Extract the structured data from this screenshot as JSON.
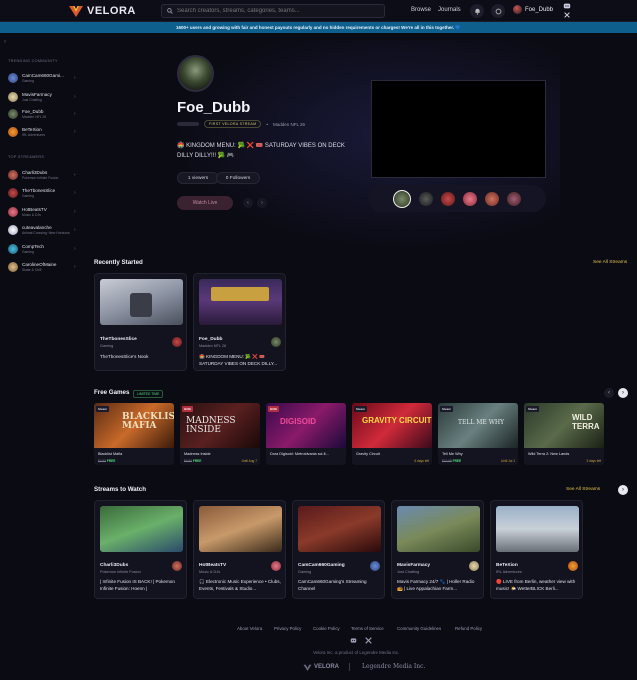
{
  "topbar": {
    "brand": "VELORA",
    "search_placeholder": "Search creators, streams, categories, teams...",
    "nav": [
      "Browse",
      "Journals"
    ],
    "user": "Foe_Dubb"
  },
  "banner": "1600+ users and growing with fair and honest payouts regularly and no hidden requirements or charges! We're all in this together. 💙",
  "sidebar": {
    "trending_heading": "TRENDING COMMUNITY",
    "trending": [
      {
        "name": "CamCam660Gami...",
        "sub": "Gaming"
      },
      {
        "name": "MavisFarmacy",
        "sub": "Just Chatting"
      },
      {
        "name": "Foe_Dubb",
        "sub": "Madden NFL 26"
      },
      {
        "name": "BeTeXion",
        "sub": "IRL Adventures"
      }
    ],
    "top_heading": "TOP STREAMERS",
    "top": [
      {
        "name": "Charli3Dubs",
        "sub": "Pokemon Infinite Fusion"
      },
      {
        "name": "TheTbonesSlice",
        "sub": "Gaming"
      },
      {
        "name": "HotBeatsTV",
        "sub": "Music & DJs"
      },
      {
        "name": "cuteavalanche",
        "sub": "Animal Crossing: New Horizons"
      },
      {
        "name": "CompTech",
        "sub": "Gaming"
      },
      {
        "name": "CarolineOfMaine",
        "sub": "Skate & Chill"
      }
    ]
  },
  "hero": {
    "name": "Foe_Dubb",
    "badge": "FIRST VELORA STREAM",
    "category": "Madden NFL 26",
    "title": "🏟️ KINGDOM MENU: 🥦 ❌ 🎟️ SATURDAY VIBES ON DECK DILLY DILLY!!! 🥦 🎮",
    "viewers": "1 viewers",
    "followers": "0 Followers",
    "watch": "Watch Live"
  },
  "recent": {
    "heading": "Recently Started",
    "see_all": "See All Streams",
    "cards": [
      {
        "name": "TheTbonesSlice",
        "sub": "Gaming",
        "desc": "TheTbonesSlice's Nook"
      },
      {
        "name": "Foe_Dubb",
        "sub": "Madden NFL 26",
        "desc": "🏟️ KINGDOM MENU: 🥦 ❌ 🎟️ SATURDAY VIBES ON DECK DILLY..."
      }
    ]
  },
  "free_games": {
    "heading": "Free Games",
    "badge": "LIMITED TIME",
    "games": [
      {
        "title": "Blacklist Mafia",
        "old": "$4.99",
        "free": "FREE",
        "days": "",
        "tag": "Steam",
        "art": "BLACKLIST MAFIA"
      },
      {
        "title": "Madness Inside",
        "old": "$9.99",
        "free": "FREE",
        "days": "Until Aug 7",
        "tag": "GOG",
        "art": "MADNESS INSIDE"
      },
      {
        "title": "Dora Digisoid: Metroidvania sci-fi...",
        "old": "",
        "free": "",
        "days": "",
        "tag": "GOG",
        "art": "DIGISOID"
      },
      {
        "title": "Gravity Circuit",
        "old": "",
        "free": "",
        "days": "6 days left",
        "tag": "Steam",
        "art": "GRAVITY CIRCUIT"
      },
      {
        "title": "Tell Me Why",
        "old": "$19.99",
        "free": "FREE",
        "days": "Until Jul 1",
        "tag": "Steam",
        "art": "TELL ME WHY"
      },
      {
        "title": "Wild Terra 2: New Lands",
        "old": "",
        "free": "",
        "days": "3 days left",
        "tag": "Steam",
        "art": "WILD TERRA"
      }
    ]
  },
  "streams": {
    "heading": "Streams to Watch",
    "see_all": "See All Streams",
    "cards": [
      {
        "name": "Charli3Dubs",
        "sub": "Pokemon Infinite Fusion",
        "desc": "| Infinite Fusion IS BACK! | Pokemon Infinite Fusion: Hoenn |"
      },
      {
        "name": "HotBeatsTV",
        "sub": "Music & DJs",
        "desc": "🎧 Electronic Music Experience • Clubs, Events, Festivals & Studio..."
      },
      {
        "name": "CamCam660Gaming",
        "sub": "Gaming",
        "desc": "CamCam660Gaming's Streaming Channel"
      },
      {
        "name": "MavisFarmacy",
        "sub": "Just Chatting",
        "desc": "Mavis Farmacy 24/7 🐾 | Holler Radio 📻 | Live Appalachian Farm..."
      },
      {
        "name": "BeTeXion",
        "sub": "IRL Adventures",
        "desc": "🔴 LIVE from Berlin, weather view with music! 🌤️ WetterBLICK Berli..."
      }
    ]
  },
  "footer": {
    "links": [
      "About Velora",
      "Privacy Policy",
      "Cookie Policy",
      "Terms of Service",
      "Community Guidelines",
      "Refund Policy"
    ],
    "product": "Velora Inc. a product of Legendre Media Inc.",
    "brand": "VELORA",
    "company": "Legendre Media Inc."
  },
  "colors": {
    "accent": "#e3c24a",
    "banner": "#0f5f8c",
    "bg": "#0b0b14",
    "free": "#4ee07a"
  }
}
